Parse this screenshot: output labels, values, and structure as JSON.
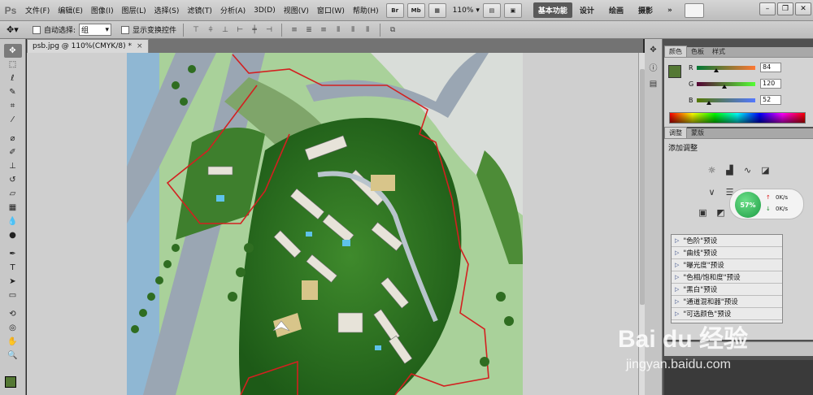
{
  "app": {
    "logo": "Ps"
  },
  "menu": [
    "文件(F)",
    "编辑(E)",
    "图像(I)",
    "图层(L)",
    "选择(S)",
    "滤镜(T)",
    "分析(A)",
    "3D(D)",
    "视图(V)",
    "窗口(W)",
    "帮助(H)"
  ],
  "menubar_buttons": [
    "Br",
    "Mb"
  ],
  "zoom": "110%",
  "workspaces": {
    "active": "基本功能",
    "items": [
      "设计",
      "绘画",
      "摄影"
    ],
    "more": "»"
  },
  "options": {
    "auto_select_label": "自动选择:",
    "auto_select_value": "组",
    "show_transform_label": "显示变换控件"
  },
  "document": {
    "tab_title": "psb.jpg @ 110%(CMYK/8) *",
    "close": "×"
  },
  "colors": {
    "foreground": "#547834",
    "background": "#ffffff"
  },
  "color_panel": {
    "tabs": [
      "颜色",
      "色板",
      "样式"
    ],
    "r": {
      "label": "R",
      "value": "84"
    },
    "g": {
      "label": "G",
      "value": "120"
    },
    "b": {
      "label": "B",
      "value": "52"
    }
  },
  "adjust_panel": {
    "tabs": [
      "调整",
      "蒙版"
    ],
    "title": "添加调整",
    "presets": [
      "\"色阶\"预设",
      "\"曲线\"预设",
      "\"曝光度\"预设",
      "\"色相/饱和度\"预设",
      "\"黑白\"预设",
      "\"通道混和器\"预设",
      "\"可选颜色\"预设"
    ]
  },
  "net_widget": {
    "percent": "57%",
    "up_rate": "0K/s",
    "down_rate": "0K/s"
  },
  "watermark": {
    "brand": "Bai du 经验",
    "url": "jingyan.baidu.com"
  }
}
